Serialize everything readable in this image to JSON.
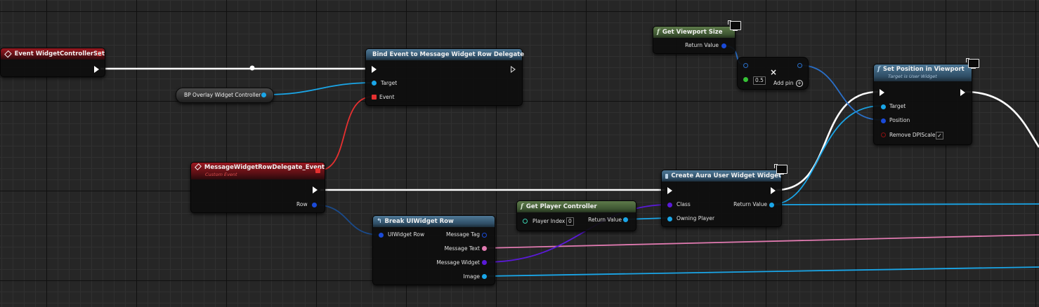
{
  "colors": {
    "exec": "#ffffff",
    "object": "#1aa6e8",
    "string": "#e07ab0",
    "class": "#5a1ad8",
    "vector": "#2a6fc8",
    "delegate": "#e53030",
    "float": "#36c236"
  },
  "nodes": {
    "event_widget_controller_set": {
      "title": "Event WidgetControllerSet",
      "icon": "event-icon"
    },
    "bp_overlay": {
      "label": "BP Overlay Widget Controller"
    },
    "bind_event": {
      "title": "Bind Event to Message Widget Row Delegate",
      "pins": {
        "target": "Target",
        "event": "Event"
      }
    },
    "custom_event": {
      "title": "MessageWidgetRowDelegate_Event",
      "subtitle": "Custom Event",
      "pins": {
        "row": "Row"
      }
    },
    "break_row": {
      "title": "Break UIWidget Row",
      "pins": {
        "input": "UIWidget Row",
        "message_tag": "Message Tag",
        "message_text": "Message Text",
        "message_widget": "Message Widget",
        "image": "Image"
      }
    },
    "get_player_controller": {
      "title": "Get Player Controller",
      "pins": {
        "player_index": "Player Index",
        "player_index_value": "0",
        "return_value": "Return Value"
      }
    },
    "create_widget": {
      "title": "Create Aura User Widget Widget",
      "pins": {
        "class": "Class",
        "owning_player": "Owning Player",
        "return_value": "Return Value"
      }
    },
    "get_viewport_size": {
      "title": "Get Viewport Size",
      "pins": {
        "return_value": "Return Value"
      }
    },
    "multiply": {
      "value": "0.5",
      "add_pin": "Add pin"
    },
    "set_position": {
      "title": "Set Position in Viewport",
      "subtitle": "Target is User Widget",
      "pins": {
        "target": "Target",
        "position": "Position",
        "remove_dpi": "Remove DPIScale"
      },
      "remove_dpi_checked": true
    }
  }
}
